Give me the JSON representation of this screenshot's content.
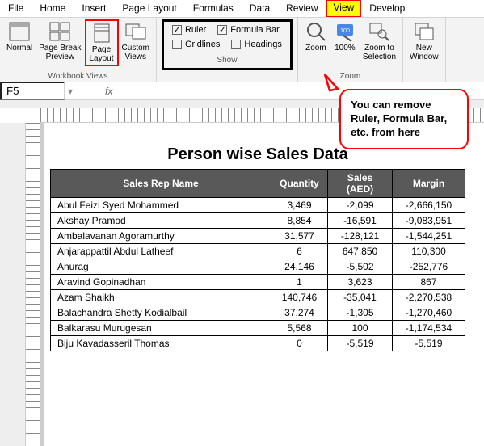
{
  "menu": {
    "file": "File",
    "home": "Home",
    "insert": "Insert",
    "page_layout": "Page Layout",
    "formulas": "Formulas",
    "data": "Data",
    "review": "Review",
    "view": "View",
    "developer": "Develop"
  },
  "ribbon": {
    "workbook_views": {
      "label": "Workbook Views",
      "normal": "Normal",
      "page_break": "Page Break\nPreview",
      "page_layout": "Page\nLayout",
      "custom": "Custom\nViews"
    },
    "show": {
      "label": "Show",
      "ruler": "Ruler",
      "formula_bar": "Formula Bar",
      "gridlines": "Gridlines",
      "headings": "Headings"
    },
    "zoom": {
      "label": "Zoom",
      "zoom": "Zoom",
      "p100": "100%",
      "zoom_sel": "Zoom to\nSelection"
    },
    "new_window": "New\nWindow"
  },
  "namebox": {
    "value": "F5",
    "fx": "fx"
  },
  "callout": "You can remove Ruler, Formula Bar, etc. from here",
  "report": {
    "title": "Person wise Sales Data",
    "headers": {
      "c1": "Sales Rep Name",
      "c2": "Quantity",
      "c3": "Sales (AED)",
      "c4": "Margin"
    },
    "rows": [
      {
        "name": "Abul Feizi Syed Mohammed",
        "qty": "3,469",
        "sales": "-2,099",
        "margin": "-2,666,150"
      },
      {
        "name": "Akshay Pramod",
        "qty": "8,854",
        "sales": "-16,591",
        "margin": "-9,083,951"
      },
      {
        "name": "Ambalavanan Agoramurthy",
        "qty": "31,577",
        "sales": "-128,121",
        "margin": "-1,544,251"
      },
      {
        "name": "Anjarappattil Abdul Latheef",
        "qty": "6",
        "sales": "647,850",
        "margin": "110,300"
      },
      {
        "name": "Anurag",
        "qty": "24,146",
        "sales": "-5,502",
        "margin": "-252,776"
      },
      {
        "name": "Aravind Gopinadhan",
        "qty": "1",
        "sales": "3,623",
        "margin": "867"
      },
      {
        "name": "Azam Shaikh",
        "qty": "140,746",
        "sales": "-35,041",
        "margin": "-2,270,538"
      },
      {
        "name": "Balachandra Shetty Kodialbail",
        "qty": "37,274",
        "sales": "-1,305",
        "margin": "-1,270,460"
      },
      {
        "name": "Balkarasu Murugesan",
        "qty": "5,568",
        "sales": "100",
        "margin": "-1,174,534"
      },
      {
        "name": "Biju Kavadasseril Thomas",
        "qty": "0",
        "sales": "-5,519",
        "margin": "-5,519"
      }
    ]
  }
}
